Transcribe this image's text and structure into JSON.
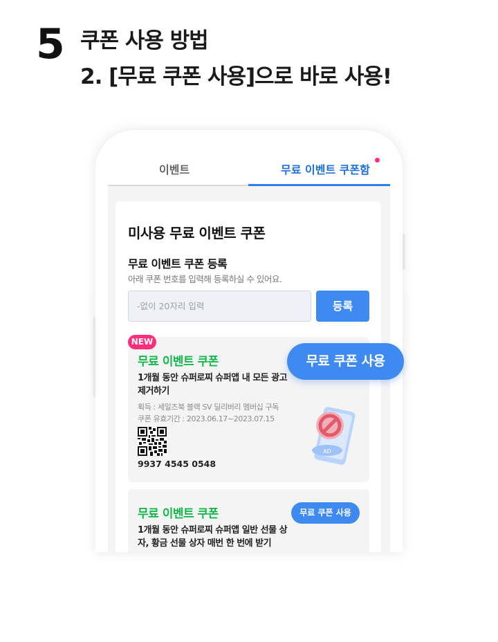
{
  "step": {
    "number": "5",
    "title": "쿠폰 사용 방법",
    "subtitle": "2. [무료 쿠폰 사용]으로 바로 사용!"
  },
  "tabs": [
    {
      "label": "이벤트",
      "active": false
    },
    {
      "label": "무료 이벤트 쿠폰함",
      "active": true,
      "has_dot": true
    }
  ],
  "section": {
    "title": "미사용 무료 이벤트 쿠폰",
    "register": {
      "title": "무료 이벤트 쿠폰 등록",
      "description": "아래 쿠폰 번호를 입력해 등록하실 수 있어요.",
      "input_placeholder": "-없이 20자리 입력",
      "button_label": "등록"
    }
  },
  "coupons": [
    {
      "badge": "NEW",
      "title": "무료 이벤트 쿠폰",
      "description": "1개월 동안 슈퍼로찌 슈퍼앱 내 모든 광고 제거하기",
      "acquired": "획득 : 세일즈북 블랙 SV 딜리버리 멤버십 구독",
      "validity": "쿠폰 유효기간 : 2023.06.17~2023.07.15",
      "code": "9937 4545 0548",
      "illustration_label": "AD",
      "use_button": "무료 쿠폰 사용"
    },
    {
      "title": "무료 이벤트 쿠폰",
      "description": "1개월 동안 슈퍼로찌 슈퍼앱 일반 선물 상자, 황금 선물 상자 매번 한 번에 받기",
      "use_button": "무료 쿠폰 사용"
    }
  ],
  "colors": {
    "accent": "#3e8af0",
    "tab_active": "#1e6fe0",
    "coupon_title": "#12b84a",
    "badge": "#ff2d7a"
  }
}
